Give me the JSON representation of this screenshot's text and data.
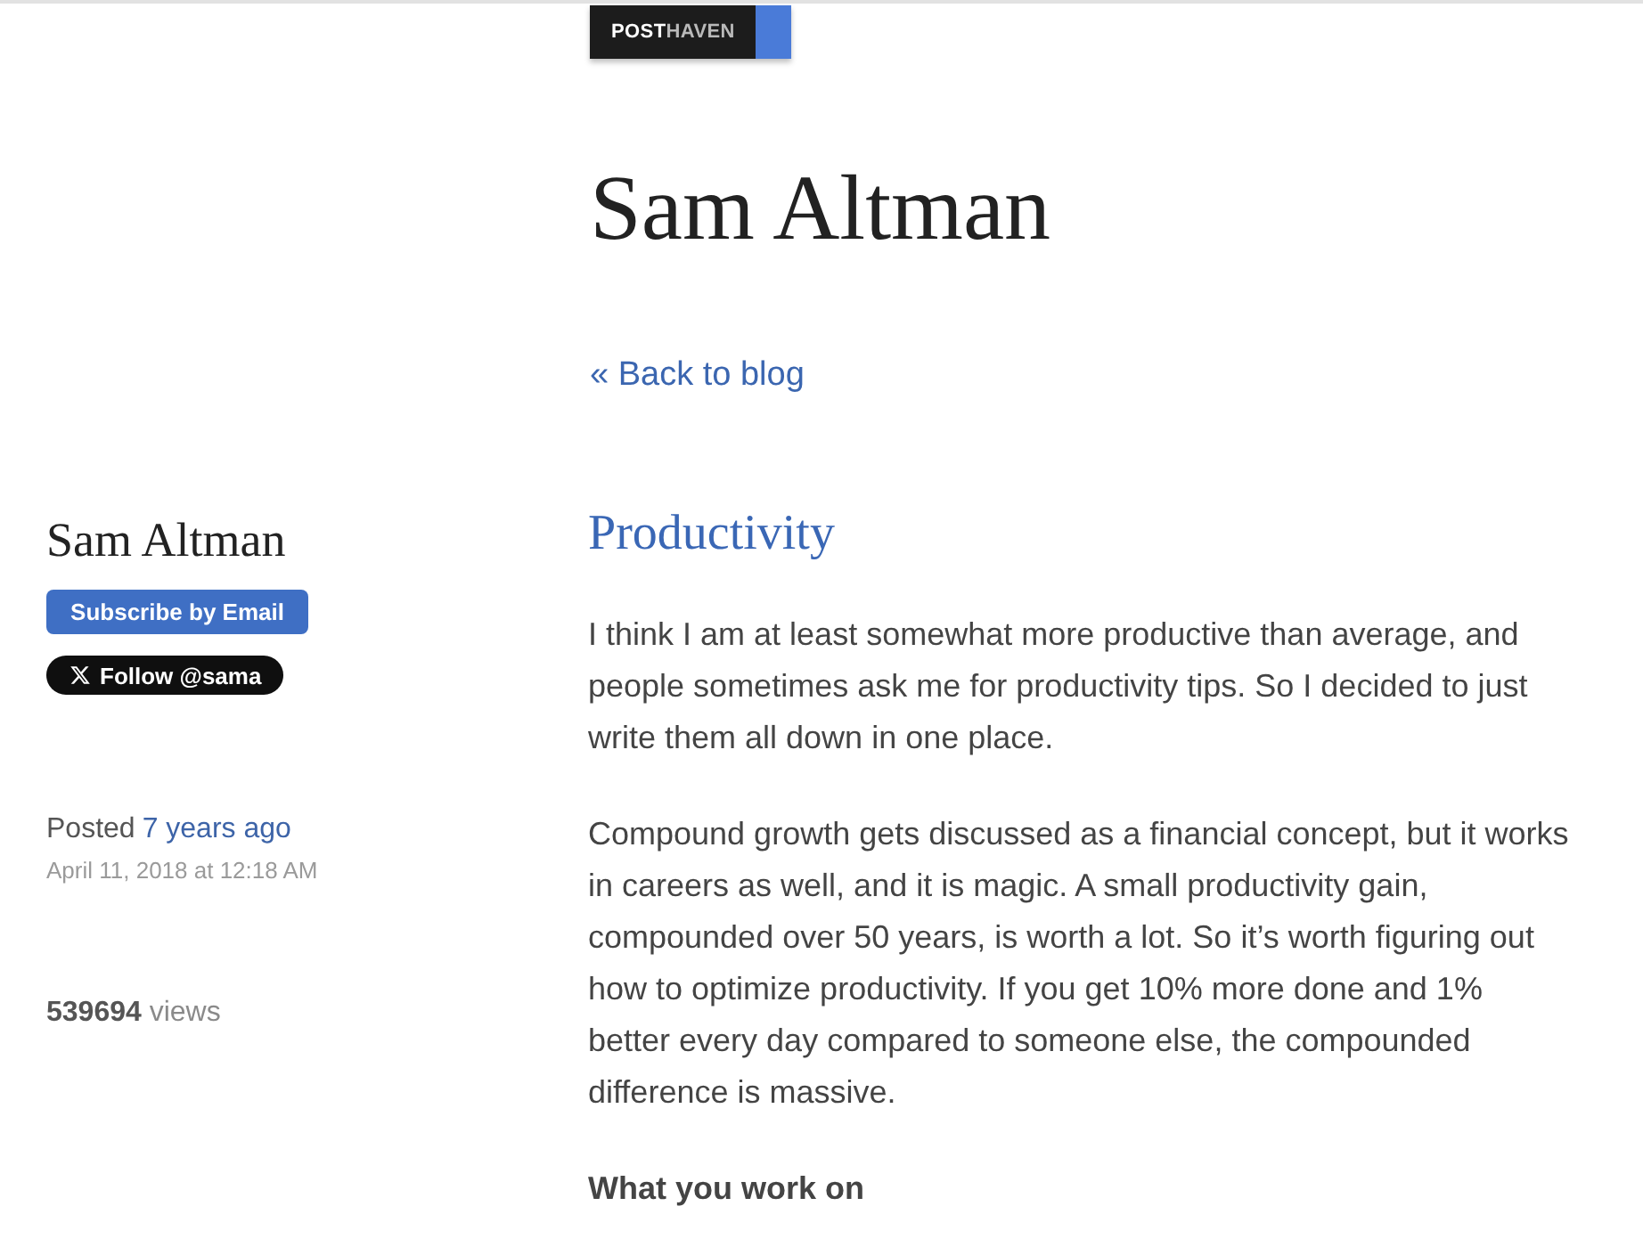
{
  "top_bar": {
    "badge": "**POST**HAVEN"
  },
  "header": {
    "title": "Sam Altman",
    "back_link": "« Back to blog"
  },
  "sidebar": {
    "author": "Sam Altman",
    "subscribe_button": "Subscribe by Email",
    "follow_button": "Follow @sama",
    "posted": {
      "label": "Posted",
      "link": "7 years ago",
      "date": "April 11, 2018 at 12:18 AM"
    },
    "views": "**539694** views"
  },
  "post": {
    "title": "Productivity",
    "blocks": [
      {
        "kind": "paragraph",
        "text": "I think I am at least somewhat more productive than average, and people sometimes ask me for productivity tips. So I decided to just write them all down in one place."
      },
      {
        "kind": "paragraph",
        "text": "Compound growth gets discussed as a financial concept, but it works in careers as well, and it is magic. A small productivity gain, compounded over 50 years, is worth a lot. So it’s worth figuring out how to optimize productivity. If you get 10% more done and 1% better every day compared to someone else, the compounded difference is massive."
      },
      {
        "kind": "heading",
        "text": "What you work on"
      }
    ]
  }
}
